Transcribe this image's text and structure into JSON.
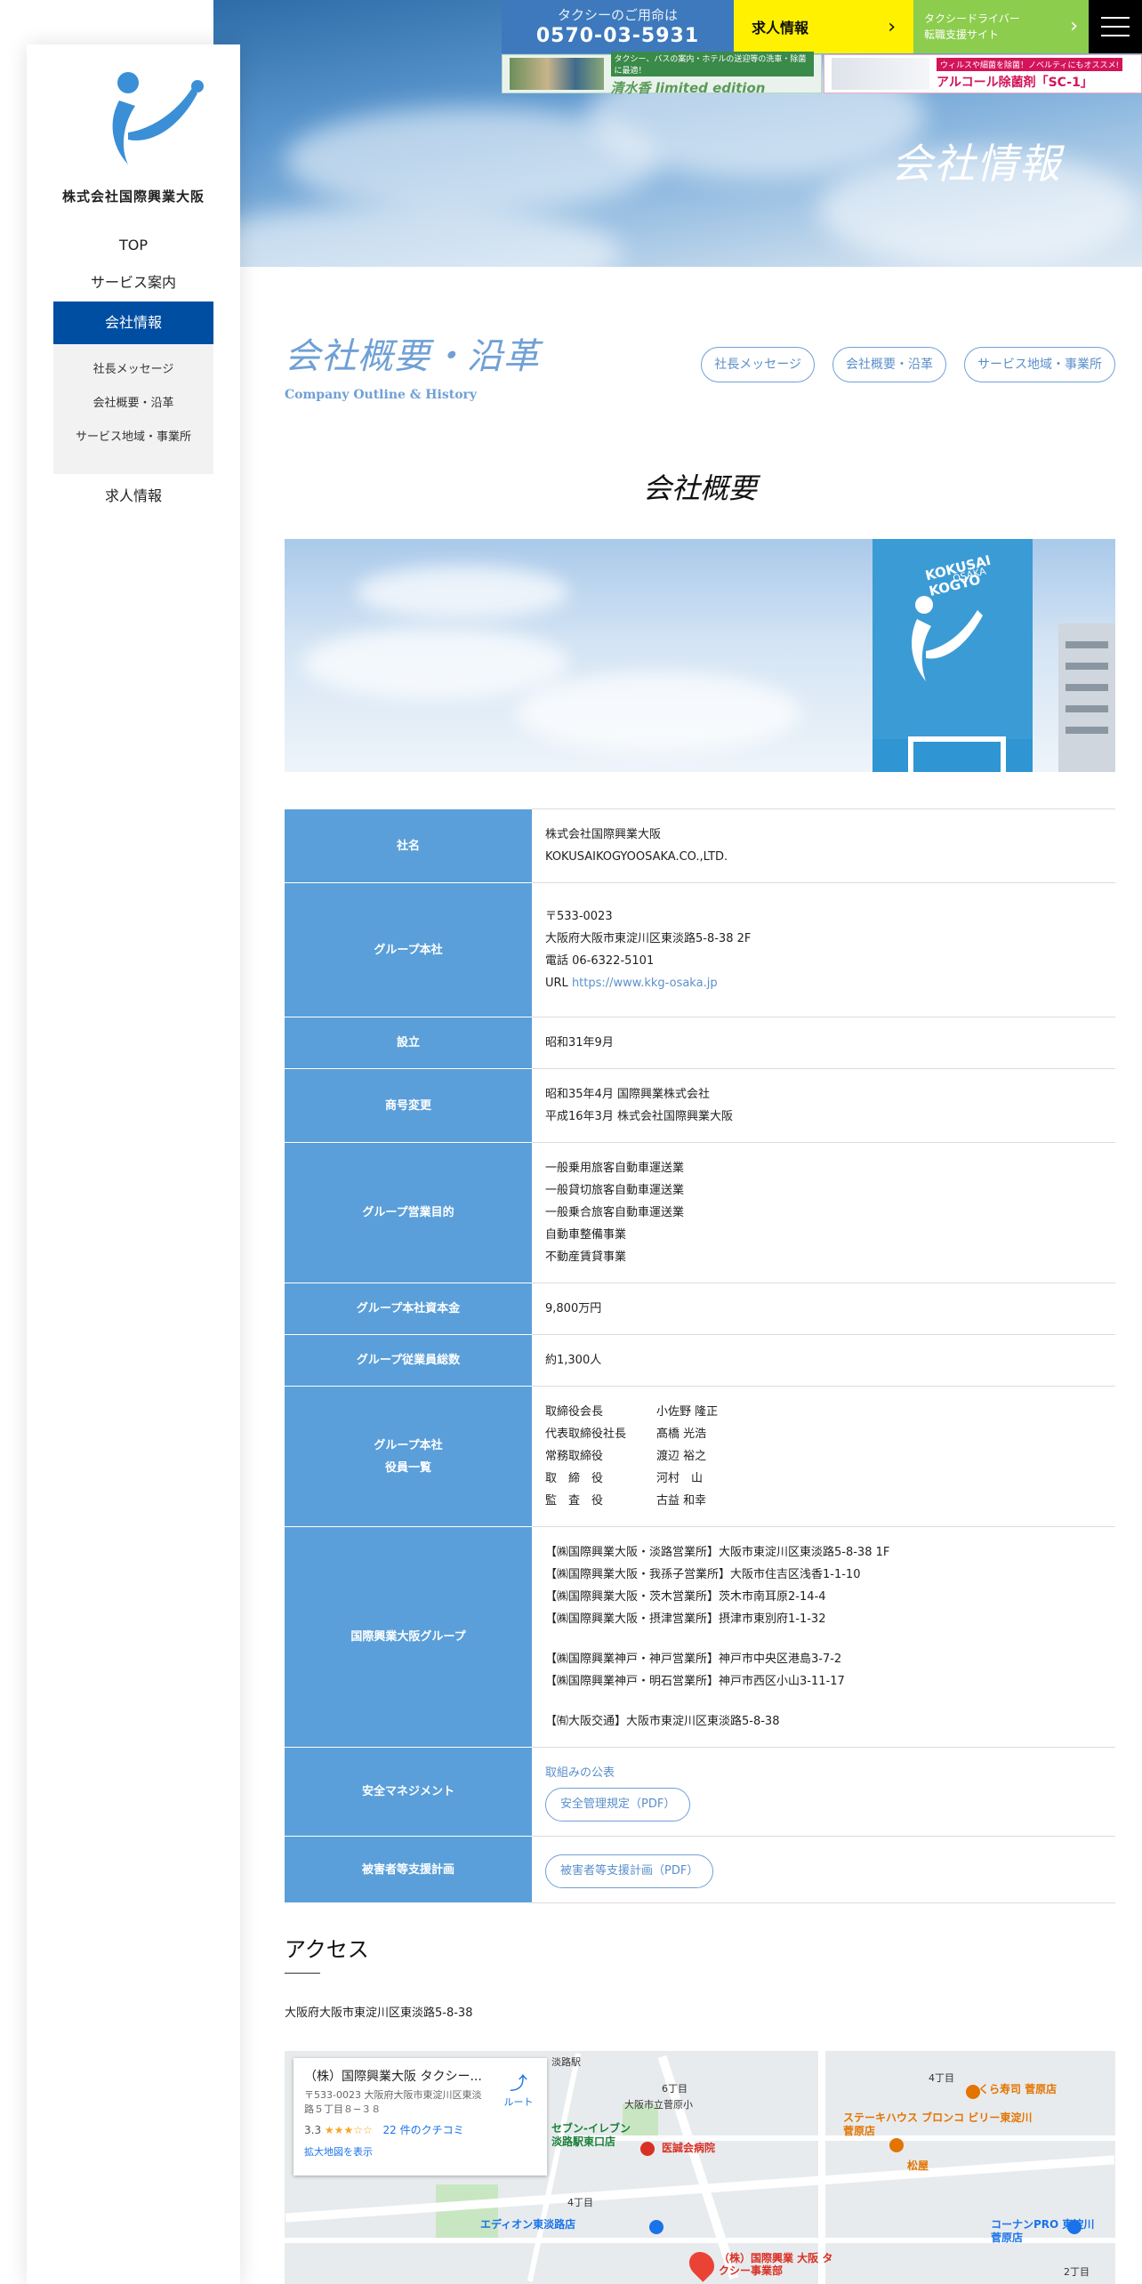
{
  "hero": {
    "title": "会社情報"
  },
  "topbar": {
    "phone_caption": "タクシーのご用命は",
    "phone_number": "0570-03-5931",
    "recruit_label": "求人情報",
    "driver_label_1": "タクシードライバー",
    "driver_label_2": "転職支援サイト"
  },
  "banners": {
    "b1_tag": "タクシー、バスの案内・ホテルの送迎等の洗車・除菌に最適！",
    "b1_text": "清水香 limited edition",
    "b2_tag": "ウィルスや細菌を除菌！ノベルティにもオススメ!",
    "b2_text": "アルコール除菌剤「SC-1」"
  },
  "sidebar": {
    "logo_text": "株式会社国際興業大阪",
    "nav": [
      {
        "label": "TOP"
      },
      {
        "label": "サービス案内"
      },
      {
        "label": "会社情報"
      },
      {
        "label": "求人情報"
      }
    ],
    "subnav": [
      {
        "label": "社長メッセージ"
      },
      {
        "label": "会社概要・沿革"
      },
      {
        "label": "サービス地域・事業所"
      }
    ]
  },
  "page": {
    "title": "会社概要・沿革",
    "subtitle": "Company Outline & History",
    "pills": [
      "社長メッセージ",
      "会社概要・沿革",
      "サービス地域・事業所"
    ],
    "section_heading": "会社概要"
  },
  "photo": {
    "sign_text_1": "KOKUSAI KOGYO",
    "sign_text_2": "OSAKA"
  },
  "table": {
    "company_name": {
      "label": "社名",
      "line1": "株式会社国際興業大阪",
      "line2": "KOKUSAIKOGYOOSAKA.CO.,LTD."
    },
    "hq": {
      "label": "グループ本社",
      "zip": "〒533-0023",
      "address": "大阪府大阪市東淀川区東淡路5-8-38 2F",
      "tel": "電話 06-6322-5101",
      "url_prefix": "URL ",
      "url": "https://www.kkg-osaka.jp"
    },
    "founded": {
      "label": "設立",
      "value": "昭和31年9月"
    },
    "name_change": {
      "label": "商号変更",
      "line1": "昭和35年4月 国際興業株式会社",
      "line2": "平成16年3月 株式会社国際興業大阪"
    },
    "business": {
      "label": "グループ営業目的",
      "items": [
        "一般乗用旅客自動車運送業",
        "一般貸切旅客自動車運送業",
        "一般乗合旅客自動車運送業",
        "自動車整備事業",
        "不動産賃貸事業"
      ]
    },
    "capital": {
      "label": "グループ本社資本金",
      "value": "9,800万円"
    },
    "employees": {
      "label": "グループ従業員総数",
      "value": "約1,300人"
    },
    "officers": {
      "label_1": "グループ本社",
      "label_2": "役員一覧",
      "rows": [
        {
          "role": "取締役会長",
          "name": "小佐野 隆正"
        },
        {
          "role": "代表取締役社長",
          "name": "髙橋 光浩"
        },
        {
          "role": "常務取締役",
          "name": "渡辺 裕之"
        },
        {
          "role": "取　締　役",
          "name": "河村　山"
        },
        {
          "role": "監　査　役",
          "name": "古益 和幸"
        }
      ]
    },
    "group": {
      "label": "国際興業大阪グループ",
      "osaka": [
        "【㈱国際興業大阪・淡路営業所】大阪市東淀川区東淡路5-8-38 1F",
        "【㈱国際興業大阪・我孫子営業所】大阪市住吉区浅香1-1-10",
        "【㈱国際興業大阪・茨木営業所】茨木市南耳原2-14-4",
        "【㈱国際興業大阪・摂津営業所】摂津市東別府1-1-32"
      ],
      "kobe": [
        "【㈱国際興業神戸・神戸営業所】神戸市中央区港島3-7-2",
        "【㈱国際興業神戸・明石営業所】神戸市西区小山3-11-17"
      ],
      "kotsu": [
        "【㈲大阪交通】大阪市東淀川区東淡路5-8-38"
      ]
    },
    "safety": {
      "label": "安全マネジメント",
      "link": "取組みの公表",
      "button": "安全管理規定（PDF）"
    },
    "victim": {
      "label": "被害者等支援計画",
      "button": "被害者等支援計画（PDF）"
    }
  },
  "access": {
    "heading": "アクセス",
    "address": "大阪府大阪市東淀川区東淡路5-8-38"
  },
  "map": {
    "card_name": "（株）国際興業大阪 タクシー...",
    "card_addr": "〒533-0023 大阪府大阪市東淀川区東淡路５丁目８−３８",
    "rating": "3.3",
    "stars": "★★★☆☆",
    "reviews": "22 件のクチコミ",
    "enlarge": "拡大地図を表示",
    "route": "ルート",
    "labels": [
      "淡路駅",
      "6丁目",
      "4丁目",
      "大阪市立菅原小",
      "くら寿司 菅原店",
      "ステーキハウス ブロンコ ビリー東淀川菅原店",
      "松屋",
      "医誠会病院",
      "セブン-イレブン 淡路駅東口店",
      "エディオン東淡路店",
      "コーナンPRO 東淀川菅原店",
      "（株）国際興業 大阪 タクシー事業部",
      "4丁目",
      "2丁目"
    ]
  }
}
